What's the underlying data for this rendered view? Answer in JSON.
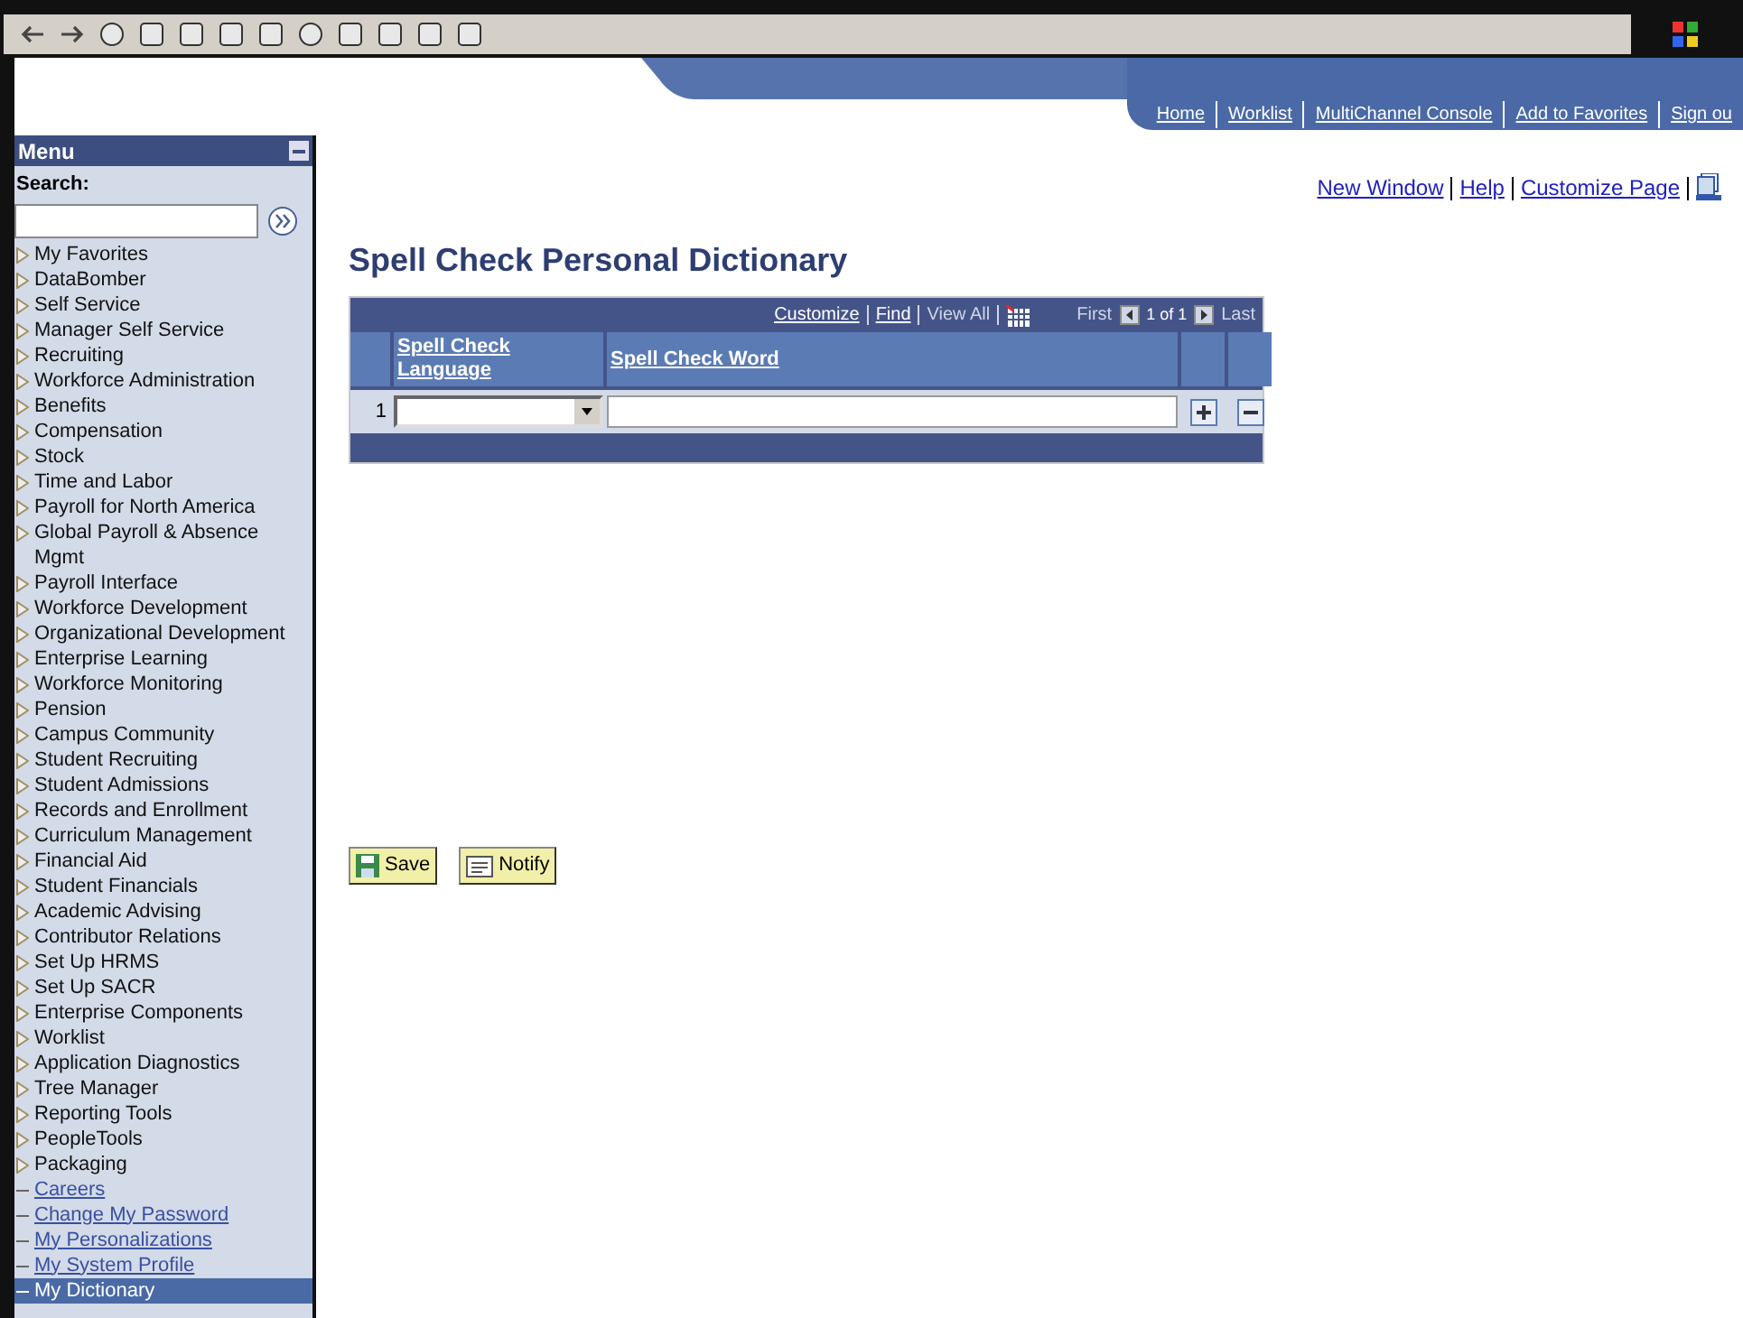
{
  "header_links": [
    "Home",
    "Worklist",
    "MultiChannel Console",
    "Add to Favorites",
    "Sign ou"
  ],
  "menu": {
    "title": "Menu",
    "search_label": "Search:",
    "items": [
      {
        "label": "My Favorites",
        "kind": "folder",
        "selected": false
      },
      {
        "label": "DataBomber",
        "kind": "folder",
        "selected": false
      },
      {
        "label": "Self Service",
        "kind": "folder",
        "selected": false
      },
      {
        "label": "Manager Self Service",
        "kind": "folder",
        "selected": false
      },
      {
        "label": "Recruiting",
        "kind": "folder",
        "selected": false
      },
      {
        "label": "Workforce Administration",
        "kind": "folder",
        "selected": false
      },
      {
        "label": "Benefits",
        "kind": "folder",
        "selected": false
      },
      {
        "label": "Compensation",
        "kind": "folder",
        "selected": false
      },
      {
        "label": "Stock",
        "kind": "folder",
        "selected": false
      },
      {
        "label": "Time and Labor",
        "kind": "folder",
        "selected": false
      },
      {
        "label": "Payroll for North America",
        "kind": "folder",
        "selected": false
      },
      {
        "label": "Global Payroll & Absence Mgmt",
        "kind": "folder",
        "selected": false
      },
      {
        "label": "Payroll Interface",
        "kind": "folder",
        "selected": false
      },
      {
        "label": "Workforce Development",
        "kind": "folder",
        "selected": false
      },
      {
        "label": "Organizational Development",
        "kind": "folder",
        "selected": false
      },
      {
        "label": "Enterprise Learning",
        "kind": "folder",
        "selected": false
      },
      {
        "label": "Workforce Monitoring",
        "kind": "folder",
        "selected": false
      },
      {
        "label": "Pension",
        "kind": "folder",
        "selected": false
      },
      {
        "label": "Campus Community",
        "kind": "folder",
        "selected": false
      },
      {
        "label": "Student Recruiting",
        "kind": "folder",
        "selected": false
      },
      {
        "label": "Student Admissions",
        "kind": "folder",
        "selected": false
      },
      {
        "label": "Records and Enrollment",
        "kind": "folder",
        "selected": false
      },
      {
        "label": "Curriculum Management",
        "kind": "folder",
        "selected": false
      },
      {
        "label": "Financial Aid",
        "kind": "folder",
        "selected": false
      },
      {
        "label": "Student Financials",
        "kind": "folder",
        "selected": false
      },
      {
        "label": "Academic Advising",
        "kind": "folder",
        "selected": false
      },
      {
        "label": "Contributor Relations",
        "kind": "folder",
        "selected": false
      },
      {
        "label": "Set Up HRMS",
        "kind": "folder",
        "selected": false
      },
      {
        "label": "Set Up SACR",
        "kind": "folder",
        "selected": false
      },
      {
        "label": "Enterprise Components",
        "kind": "folder",
        "selected": false
      },
      {
        "label": "Worklist",
        "kind": "folder",
        "selected": false
      },
      {
        "label": "Application Diagnostics",
        "kind": "folder",
        "selected": false
      },
      {
        "label": "Tree Manager",
        "kind": "folder",
        "selected": false
      },
      {
        "label": "Reporting Tools",
        "kind": "folder",
        "selected": false
      },
      {
        "label": "PeopleTools",
        "kind": "folder",
        "selected": false
      },
      {
        "label": "Packaging",
        "kind": "folder",
        "selected": false
      },
      {
        "label": "Careers",
        "kind": "link",
        "selected": false
      },
      {
        "label": "Change My Password",
        "kind": "link",
        "selected": false
      },
      {
        "label": "My Personalizations",
        "kind": "link",
        "selected": false
      },
      {
        "label": "My System Profile",
        "kind": "link",
        "selected": false
      },
      {
        "label": "My Dictionary",
        "kind": "link",
        "selected": true
      }
    ]
  },
  "page_links": [
    "New Window",
    "Help",
    "Customize Page"
  ],
  "title": "Spell Check Personal Dictionary",
  "grid": {
    "toolbar": {
      "customize": "Customize",
      "find": "Find",
      "view_all": "View All",
      "first": "First",
      "count": "1 of 1",
      "last": "Last"
    },
    "columns": [
      "Spell Check Language",
      "Spell Check Word"
    ],
    "rows": [
      {
        "number": "1"
      }
    ]
  },
  "buttons": [
    {
      "label": "Save",
      "kind": "save"
    },
    {
      "label": "Notify",
      "kind": "notify"
    }
  ]
}
